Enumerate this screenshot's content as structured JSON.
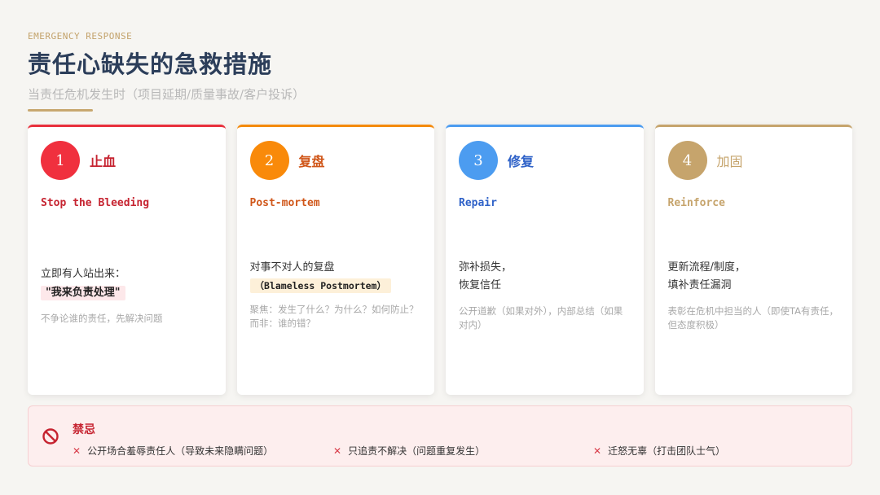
{
  "header": {
    "eyebrow": "EMERGENCY RESPONSE",
    "title": "责任心缺失的急救措施",
    "subtitle": "当责任危机发生时（项目延期/质量事故/客户投诉）"
  },
  "colors": {
    "card1": "#e8303c",
    "card2": "#f48a0c",
    "card3": "#4c9cf0",
    "card4": "#c6a46c",
    "title1": "#c62431",
    "title2": "#d0571a",
    "title3": "#2f62c8",
    "title4": "#c6a46c"
  },
  "cards": [
    {
      "num": "1",
      "title": "止血",
      "en": "Stop the Bleeding",
      "main": [
        "立即有人站出来："
      ],
      "highlight": "\"我来负责处理\"",
      "note": "不争论谁的责任，先解决问题"
    },
    {
      "num": "2",
      "title": "复盘",
      "en": "Post-mortem",
      "main": [
        "对事不对人的复盘"
      ],
      "highlight": "（Blameless Postmortem）",
      "note": "聚焦：发生了什么？为什么？如何防止？而非：谁的错？"
    },
    {
      "num": "3",
      "title": "修复",
      "en": "Repair",
      "main": [
        "弥补损失，",
        "恢复信任"
      ],
      "highlight": "",
      "note": "公开道歉（如果对外），内部总结（如果对内）"
    },
    {
      "num": "4",
      "title": "加固",
      "en": "Reinforce",
      "main": [
        "更新流程/制度，",
        "填补责任漏洞"
      ],
      "highlight": "",
      "note": "表彰在危机中担当的人（即使TA有责任，但态度积极）"
    }
  ],
  "forbidden": {
    "title": "禁忌",
    "icon": "ban-icon",
    "items": [
      "公开场合羞辱责任人（导致未来隐瞒问题）",
      "只追责不解决（问题重复发生）",
      "迁怒无辜（打击团队士气）"
    ],
    "mark": "✕"
  }
}
